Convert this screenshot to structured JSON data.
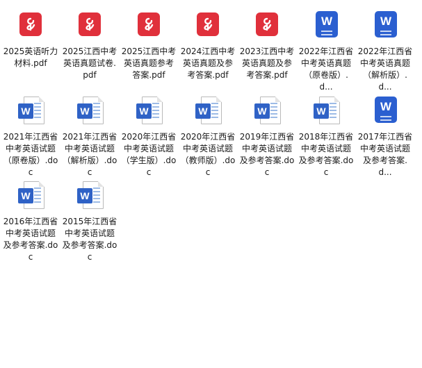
{
  "colors": {
    "pdf_red": "#e0303b",
    "word_blue": "#2b5fd0",
    "word_badge": "#2f62c6"
  },
  "files": [
    {
      "label": "2025英语听力材料.pdf",
      "icon": "pdf-icon"
    },
    {
      "label": "2025江西中考英语真题试卷.pdf",
      "icon": "pdf-icon"
    },
    {
      "label": "2025江西中考英语真题参考答案.pdf",
      "icon": "pdf-icon"
    },
    {
      "label": "2024江西中考英语真题及参考答案.pdf",
      "icon": "pdf-icon"
    },
    {
      "label": "2023江西中考英语真题及参考答案.pdf",
      "icon": "pdf-icon"
    },
    {
      "label": "2022年江西省中考英语真题（原卷版）.d...",
      "icon": "word-docx-icon"
    },
    {
      "label": "2022年江西省中考英语真题（解析版）.d...",
      "icon": "word-docx-icon"
    },
    {
      "label": "2021年江西省中考英语试题（原卷版）.doc",
      "icon": "word-doc-icon"
    },
    {
      "label": "2021年江西省中考英语试题（解析版）.doc",
      "icon": "word-doc-icon"
    },
    {
      "label": "2020年江西省中考英语试题（学生版）.doc",
      "icon": "word-doc-icon"
    },
    {
      "label": "2020年江西省中考英语试题（教师版）.doc",
      "icon": "word-doc-icon"
    },
    {
      "label": "2019年江西省中考英语试题及参考答案.doc",
      "icon": "word-doc-icon"
    },
    {
      "label": "2018年江西省中考英语试题及参考答案.doc",
      "icon": "word-doc-icon"
    },
    {
      "label": "2017年江西省中考英语试题及参考答案.d...",
      "icon": "word-docx-icon"
    },
    {
      "label": "2016年江西省中考英语试题及参考答案.doc",
      "icon": "word-doc-icon"
    },
    {
      "label": "2015年江西省中考英语试题及参考答案.doc",
      "icon": "word-doc-icon"
    }
  ]
}
